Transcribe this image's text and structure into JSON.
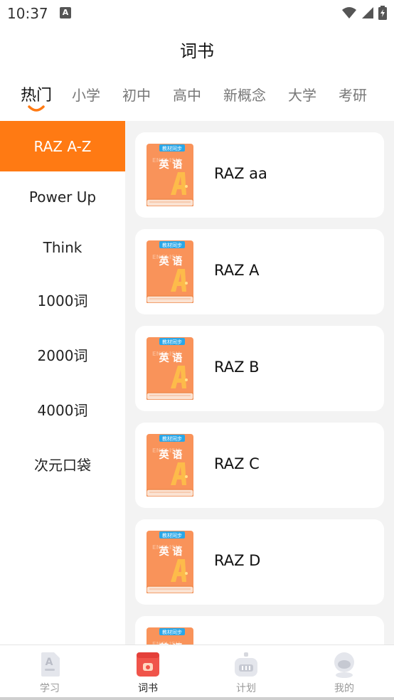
{
  "status_bar": {
    "time": "10:37",
    "icons": [
      "text-a-icon",
      "wifi-icon",
      "signal-icon",
      "battery-icon"
    ]
  },
  "header": {
    "title": "词书"
  },
  "tabs": [
    {
      "label": "热门",
      "active": true
    },
    {
      "label": "小学",
      "active": false
    },
    {
      "label": "初中",
      "active": false
    },
    {
      "label": "高中",
      "active": false
    },
    {
      "label": "新概念",
      "active": false
    },
    {
      "label": "大学",
      "active": false
    },
    {
      "label": "考研",
      "active": false
    }
  ],
  "left_nav": [
    {
      "label": "RAZ A-Z",
      "active": true
    },
    {
      "label": "Power Up",
      "active": false
    },
    {
      "label": "Think",
      "active": false
    },
    {
      "label": "1000词",
      "active": false
    },
    {
      "label": "2000词",
      "active": false
    },
    {
      "label": "4000词",
      "active": false
    },
    {
      "label": "次元口袋",
      "active": false
    }
  ],
  "books": [
    {
      "title": "RAZ aa"
    },
    {
      "title": "RAZ A"
    },
    {
      "title": "RAZ B"
    },
    {
      "title": "RAZ C"
    },
    {
      "title": "RAZ D"
    },
    {
      "title": ""
    }
  ],
  "book_cover": {
    "badge": "教材同步",
    "text": "英 语"
  },
  "bottom_nav": [
    {
      "label": "学习",
      "icon": "study-icon",
      "active": false
    },
    {
      "label": "词书",
      "icon": "wordbook-icon",
      "active": true
    },
    {
      "label": "计划",
      "icon": "plan-icon",
      "active": false
    },
    {
      "label": "我的",
      "icon": "profile-icon",
      "active": false
    }
  ],
  "colors": {
    "accent": "#ff7a13",
    "content_bg": "#f3f3f3",
    "cover_orange": "#f9935a",
    "badge_blue": "#2aa7e8"
  }
}
